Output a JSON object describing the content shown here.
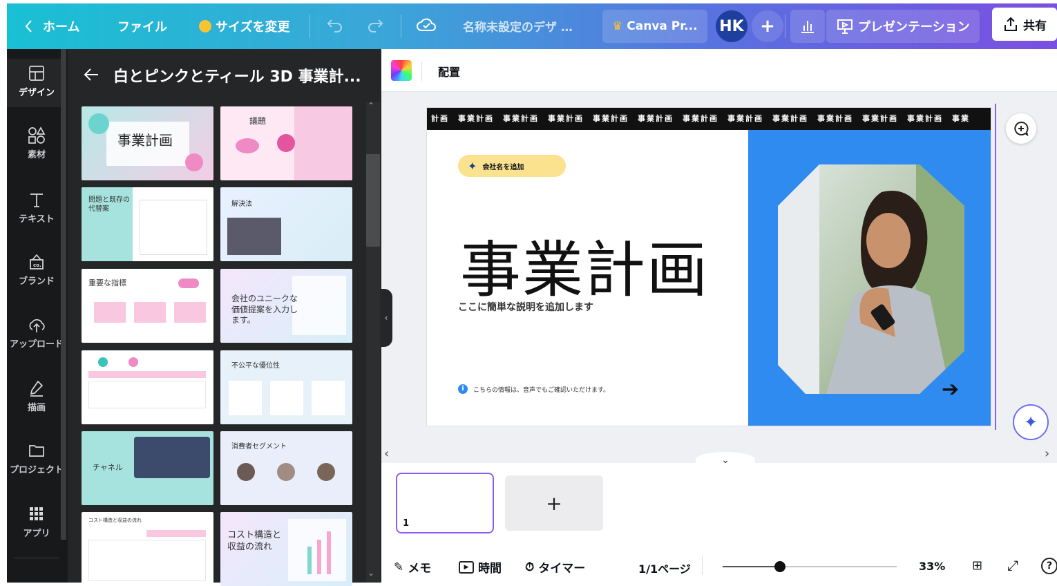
{
  "topbar": {
    "home": "ホーム",
    "file": "ファイル",
    "resize": "サイズを変更",
    "design_name": "名称未設定のデザ …",
    "pro": "Canva Pr...",
    "avatar": "HK",
    "present": "プレゼンテーション",
    "share": "共有"
  },
  "rail": [
    {
      "icon": "layout-icon",
      "label": "デザイン"
    },
    {
      "icon": "elements-icon",
      "label": "素材"
    },
    {
      "icon": "text-icon",
      "label": "テキスト"
    },
    {
      "icon": "brand-icon",
      "label": "ブランド"
    },
    {
      "icon": "upload-icon",
      "label": "アップロード"
    },
    {
      "icon": "draw-icon",
      "label": "描画"
    },
    {
      "icon": "folder-icon",
      "label": "プロジェクト"
    },
    {
      "icon": "apps-icon",
      "label": "アプリ"
    }
  ],
  "panel": {
    "title": "白とピンクとティール 3D 事業計...",
    "thumbs": [
      {
        "title": "事業計画"
      },
      {
        "title": "議題"
      },
      {
        "title": "問題と既存の代替案"
      },
      {
        "title": "解決法"
      },
      {
        "title": "重要な指標"
      },
      {
        "title": "会社のユニークな価値提案を入力します。"
      },
      {
        "title": ""
      },
      {
        "title": "不公平な優位性"
      },
      {
        "title": "チャネル"
      },
      {
        "title": "消費者セグメント"
      },
      {
        "title": "コスト構造と収益の流れ"
      },
      {
        "title": "コスト構造と収益の流れ"
      }
    ]
  },
  "ctx": {
    "position": "配置"
  },
  "slide": {
    "ticker": "計画　事業計画　事業計画　事業計画　事業計画　事業計画　事業計画　事業計画　事業計画　事業計画　事業計画　事業計画　事業",
    "company": "会社名を追加",
    "title": "事業計画",
    "subtitle": "ここに簡単な説明を追加します",
    "info": "こちらの情報は、音声でもご確認いただけます。"
  },
  "pages": {
    "page_number": "1"
  },
  "bottom": {
    "notes": "メモ",
    "duration": "時間",
    "timer": "タイマー",
    "page": "1/1ページ",
    "zoom": "33%",
    "zoom_level": 0.33
  }
}
